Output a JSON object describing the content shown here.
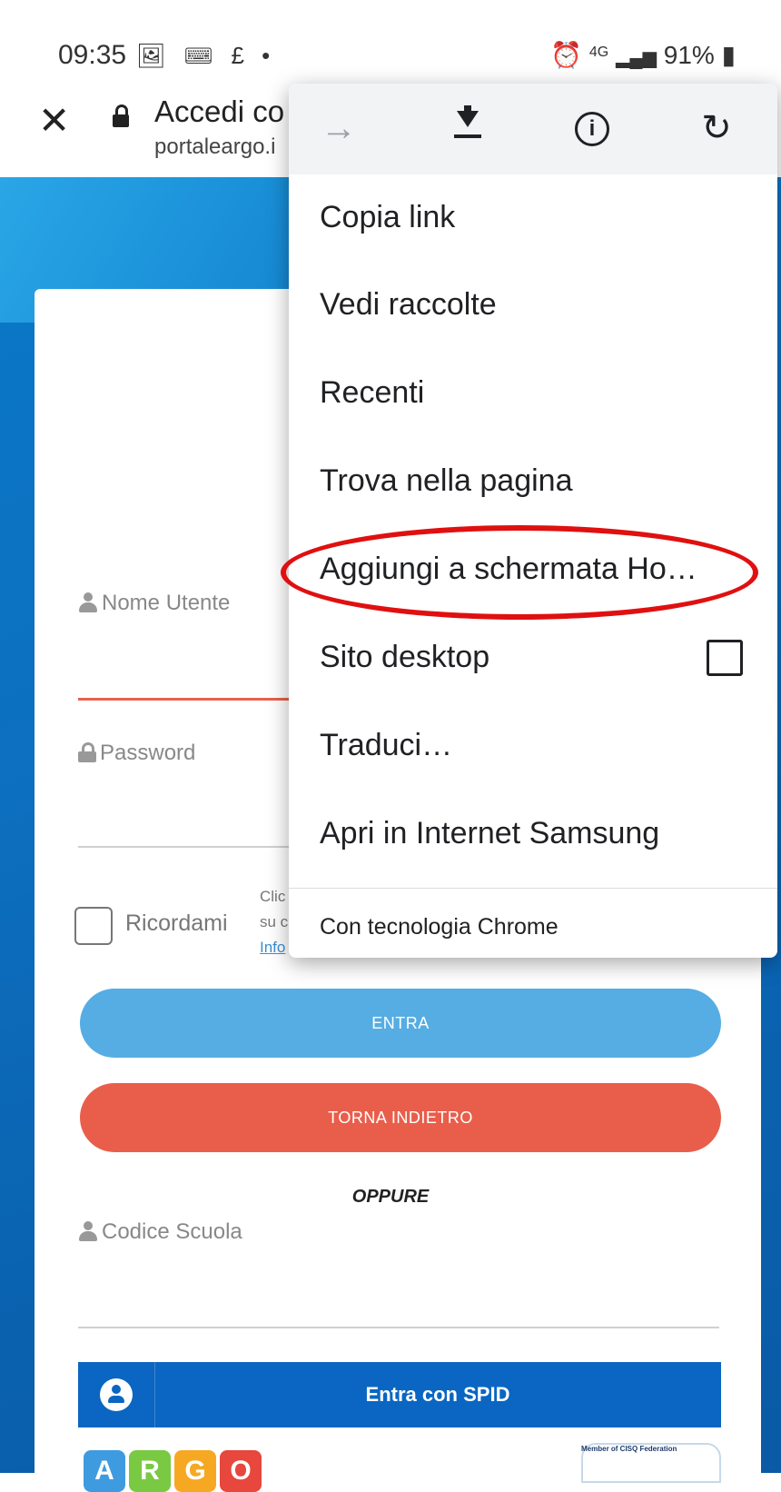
{
  "status_bar": {
    "time": "09:35",
    "left_icons": "🖼 ⌨ £ •",
    "network": "4G",
    "battery": "91%"
  },
  "url_bar": {
    "close_icon": "close-icon",
    "title": "Accedi co",
    "domain": "portaleargo.i"
  },
  "login": {
    "username_label": "Nome Utente",
    "password_label": "Password",
    "remember_label": "Ricordami",
    "info_line1": "Clic",
    "info_line2": "su c",
    "info_link": "Info",
    "enter_button": "ENTRA",
    "back_button": "TORNA INDIETRO",
    "or_text": "OPPURE",
    "school_code_label": "Codice Scuola",
    "spid_button": "Entra con SPID",
    "cisq_text": "Member of CISQ Federation"
  },
  "logo_tiles": [
    {
      "letter": "A",
      "color": "#3f9be0"
    },
    {
      "letter": "R",
      "color": "#7ac943"
    },
    {
      "letter": "G",
      "color": "#f7a823"
    },
    {
      "letter": "O",
      "color": "#e7473c"
    }
  ],
  "menu": {
    "toolbar_icons": [
      "forward-icon",
      "download-icon",
      "info-icon",
      "reload-icon"
    ],
    "items": [
      {
        "label": "Copia link"
      },
      {
        "label": "Vedi raccolte"
      },
      {
        "label": "Recenti"
      },
      {
        "label": "Trova nella pagina"
      },
      {
        "label": "Aggiungi a schermata Ho…"
      },
      {
        "label": "Sito desktop",
        "checked": false
      },
      {
        "label": "Traduci…"
      },
      {
        "label": "Apri in Internet Samsung"
      }
    ],
    "footer": "Con tecnologia Chrome"
  },
  "colors": {
    "accent_blue": "#55ade3",
    "back_red": "#e95e4b",
    "spid_blue": "#0a66c2",
    "annotation_red": "#e01010"
  }
}
